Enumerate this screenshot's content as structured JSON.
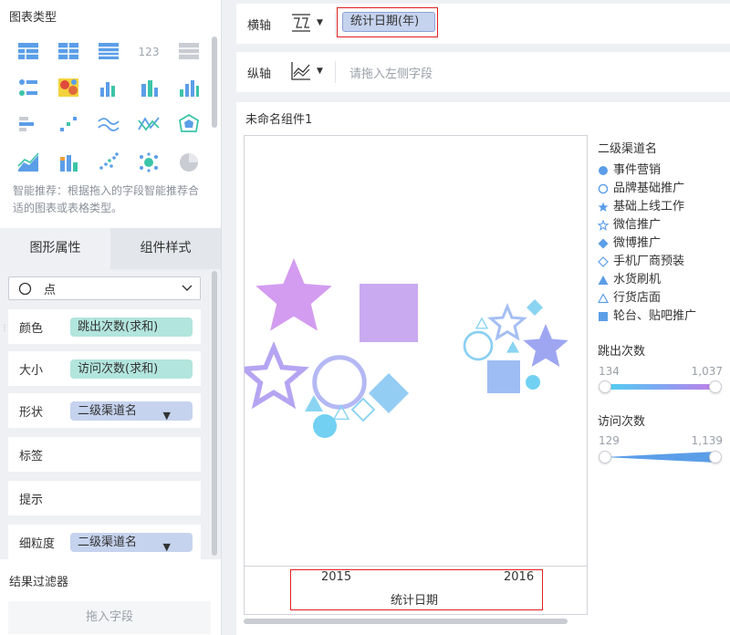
{
  "left_panel": {
    "chart_types_title": "图表类型",
    "smart_hint": "智能推荐：根据拖入的字段智能推荐合适的图表或表格类型。",
    "tabs": [
      {
        "label": "图形属性",
        "active": true
      },
      {
        "label": "组件样式",
        "active": false
      }
    ],
    "mark_type": {
      "icon": "circle-outline-icon",
      "label": "点"
    },
    "attributes": [
      {
        "label": "颜色",
        "field": "跳出次数(求和)",
        "pill_color": "#b2e5dd",
        "has_filter": false
      },
      {
        "label": "大小",
        "field": "访问次数(求和)",
        "pill_color": "#b2e5dd",
        "has_filter": false
      },
      {
        "label": "形状",
        "field": "二级渠道名",
        "pill_color": "#c6d3ee",
        "has_filter": true
      },
      {
        "label": "标签",
        "field": "",
        "has_filter": false
      },
      {
        "label": "提示",
        "field": "",
        "has_filter": false
      },
      {
        "label": "细粒度",
        "field": "二级渠道名",
        "pill_color": "#c6d3ee",
        "has_filter": true
      }
    ],
    "result_filter_title": "结果过滤器",
    "dropzone_label": "拖入字段"
  },
  "axes": {
    "x": {
      "label": "横轴",
      "field": "统计日期(年)"
    },
    "y": {
      "label": "纵轴",
      "placeholder": "请拖入左侧字段"
    }
  },
  "component": {
    "title": "未命名组件1",
    "x_ticks": [
      "2015",
      "2016"
    ],
    "x_title": "统计日期"
  },
  "legend": {
    "shape_title": "二级渠道名",
    "items": [
      {
        "label": "事件营销",
        "symbol": "filled-circle"
      },
      {
        "label": "品牌基础推广",
        "symbol": "hollow-circle"
      },
      {
        "label": "基础上线工作",
        "symbol": "filled-star"
      },
      {
        "label": "微信推广",
        "symbol": "hollow-star"
      },
      {
        "label": "微博推广",
        "symbol": "filled-diamond"
      },
      {
        "label": "手机厂商预装",
        "symbol": "hollow-diamond"
      },
      {
        "label": "水货刷机",
        "symbol": "filled-triangle"
      },
      {
        "label": "行货店面",
        "symbol": "hollow-triangle"
      },
      {
        "label": "轮台、贴吧推广",
        "symbol": "filled-square"
      }
    ],
    "color_title": "跳出次数",
    "color_min": "134",
    "color_max": "1,037",
    "size_title": "访问次数",
    "size_min": "129",
    "size_max": "1,139",
    "accent_color": "#5b9ee8"
  },
  "chart_data": {
    "type": "scatter",
    "categories": [
      "2015",
      "2016"
    ],
    "x_title": "统计日期",
    "color_field": "跳出次数",
    "color_range": [
      134,
      1037
    ],
    "size_field": "访问次数",
    "size_range": [
      129,
      1139
    ],
    "points": [
      {
        "x": "2015",
        "shape": "filled-star",
        "color": "#d39cf0"
      },
      {
        "x": "2015",
        "shape": "filled-square",
        "color": "#c9aaf0"
      },
      {
        "x": "2015",
        "shape": "hollow-star",
        "color": "#b5a4f2"
      },
      {
        "x": "2015",
        "shape": "hollow-circle",
        "color": "#b4b8f4"
      },
      {
        "x": "2015",
        "shape": "filled-diamond",
        "color": "#94cdf4"
      },
      {
        "x": "2015",
        "shape": "filled-triangle",
        "color": "#8ad4f2"
      },
      {
        "x": "2015",
        "shape": "hollow-triangle",
        "color": "#8ad4f2"
      },
      {
        "x": "2015",
        "shape": "hollow-diamond",
        "color": "#8ad4f2"
      },
      {
        "x": "2015",
        "shape": "filled-circle",
        "color": "#72d0f2"
      },
      {
        "x": "2016",
        "shape": "filled-diamond",
        "color": "#8ad4f2"
      },
      {
        "x": "2016",
        "shape": "hollow-star",
        "color": "#a6bff4"
      },
      {
        "x": "2016",
        "shape": "hollow-triangle",
        "color": "#8ad4f2"
      },
      {
        "x": "2016",
        "shape": "hollow-circle",
        "color": "#8acff2"
      },
      {
        "x": "2016",
        "shape": "filled-triangle",
        "color": "#8ad4f2"
      },
      {
        "x": "2016",
        "shape": "filled-star",
        "color": "#9ea6f2"
      },
      {
        "x": "2016",
        "shape": "filled-square",
        "color": "#9ebdf4"
      },
      {
        "x": "2016",
        "shape": "filled-circle",
        "color": "#72d0f2"
      }
    ]
  }
}
